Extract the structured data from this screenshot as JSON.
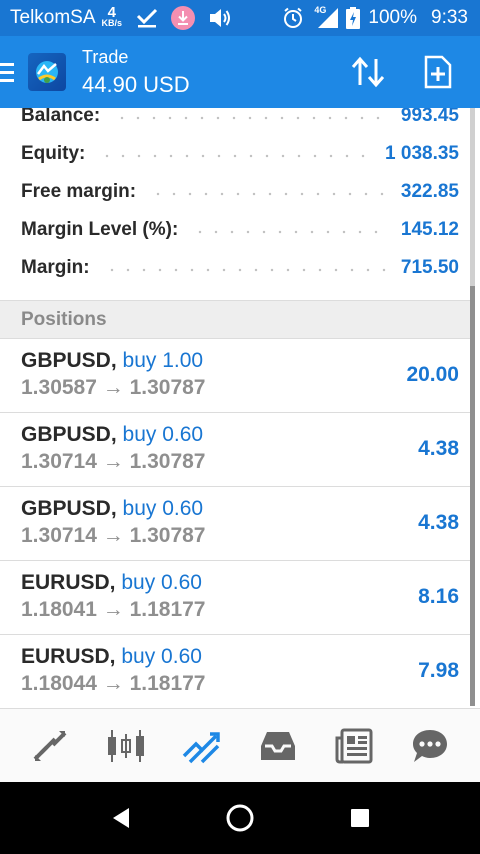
{
  "status_bar": {
    "carrier": "TelkomSA",
    "speed_value": "4",
    "speed_unit": "KB/s",
    "network": "4G",
    "battery": "100%",
    "time": "9:33",
    "icons": [
      "check-icon",
      "download-icon",
      "volume-icon",
      "alarm-icon",
      "signal-icon",
      "battery-icon"
    ]
  },
  "app_bar": {
    "title": "Trade",
    "subtitle": "44.90 USD",
    "icons": [
      "menu-icon",
      "app-logo",
      "sort-icon",
      "new-order-icon"
    ]
  },
  "account": [
    {
      "label": "Balance:",
      "value": "993.45"
    },
    {
      "label": "Equity:",
      "value": "1 038.35"
    },
    {
      "label": "Free margin:",
      "value": "322.85"
    },
    {
      "label": "Margin Level (%):",
      "value": "145.12"
    },
    {
      "label": "Margin:",
      "value": "715.50"
    }
  ],
  "positions_header": "Positions",
  "positions": [
    {
      "symbol": "GBPUSD,",
      "side": "buy 1.00",
      "prices": "1.30587 → 1.30787",
      "profit": "20.00"
    },
    {
      "symbol": "GBPUSD,",
      "side": "buy 0.60",
      "prices": "1.30714 → 1.30787",
      "profit": "4.38"
    },
    {
      "symbol": "GBPUSD,",
      "side": "buy 0.60",
      "prices": "1.30714 → 1.30787",
      "profit": "4.38"
    },
    {
      "symbol": "EURUSD,",
      "side": "buy 0.60",
      "prices": "1.18041 → 1.18177",
      "profit": "8.16"
    },
    {
      "symbol": "EURUSD,",
      "side": "buy 0.60",
      "prices": "1.18044 → 1.18177",
      "profit": "7.98"
    }
  ],
  "bottom_nav": {
    "items": [
      "quotes-icon",
      "chart-icon",
      "trade-icon",
      "history-icon",
      "news-icon",
      "chat-icon"
    ],
    "active": "trade-icon"
  },
  "colors": {
    "status_bar": "#1976d2",
    "app_bar": "#1e88e5",
    "accent": "#1976d2",
    "nav_inactive": "#666666"
  }
}
